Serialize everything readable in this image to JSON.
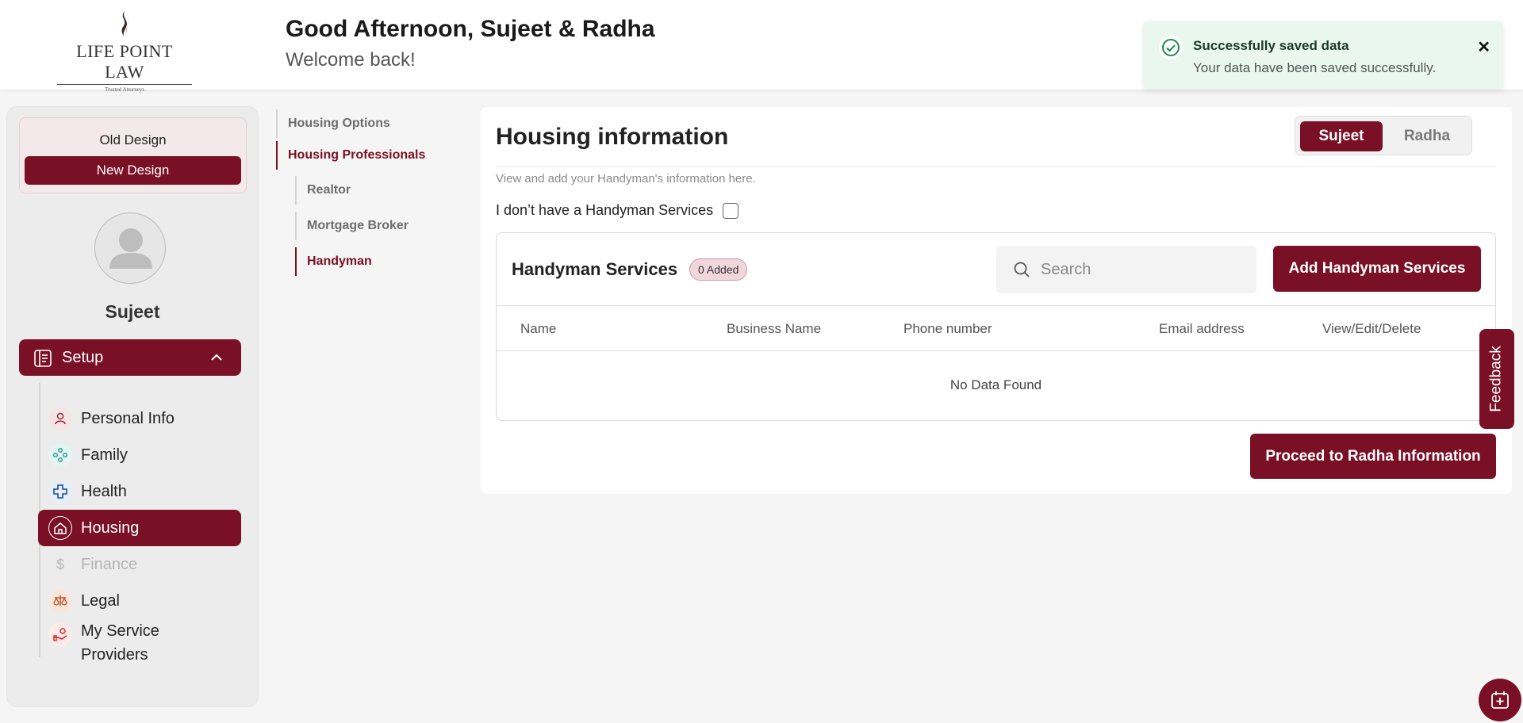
{
  "header": {
    "logo_text": "LIFE POINT LAW",
    "logo_tagline": "Trusted Attorneys",
    "greeting": "Good Afternoon, Sujeet & Radha",
    "welcome": "Welcome back!"
  },
  "toast": {
    "title": "Successfully saved data",
    "message": "Your data have been saved successfully.",
    "close": "✕"
  },
  "sidebar": {
    "old_design": "Old Design",
    "new_design": "New Design",
    "user_name": "Sujeet",
    "setup_label": "Setup",
    "items": [
      {
        "label": "Personal Info",
        "icon": "person-icon"
      },
      {
        "label": "Family",
        "icon": "family-icon"
      },
      {
        "label": "Health",
        "icon": "health-cross-icon"
      },
      {
        "label": "Housing",
        "icon": "house-icon",
        "active": true
      },
      {
        "label": "Finance",
        "icon": "dollar-icon",
        "disabled": true
      },
      {
        "label": "Legal",
        "icon": "scales-icon"
      },
      {
        "label": "My Service Providers",
        "icon": "service-hand-icon"
      }
    ]
  },
  "subnav": {
    "housing_options": "Housing Options",
    "housing_professionals": "Housing Professionals",
    "realtor": "Realtor",
    "mortgage_broker": "Mortgage Broker",
    "handyman": "Handyman"
  },
  "main": {
    "title": "Housing information",
    "toggle_on": "Sujeet",
    "toggle_off": "Radha",
    "description": "View and add your Handyman's information here.",
    "no_have_label": "I don’t have a Handyman Services",
    "section_title": "Handyman Services",
    "badge": "0 Added",
    "search_placeholder": "Search",
    "add_button": "Add Handyman Services",
    "columns": [
      "Name",
      "Business Name",
      "Phone number",
      "Email address",
      "View/Edit/Delete"
    ],
    "empty_text": "No Data Found",
    "proceed_button": "Proceed to Radha Information"
  },
  "feedback_label": "Feedback",
  "colors": {
    "brand": "#7a1025",
    "toast_bg": "#e9f7ee",
    "success": "#1e8a4c"
  }
}
